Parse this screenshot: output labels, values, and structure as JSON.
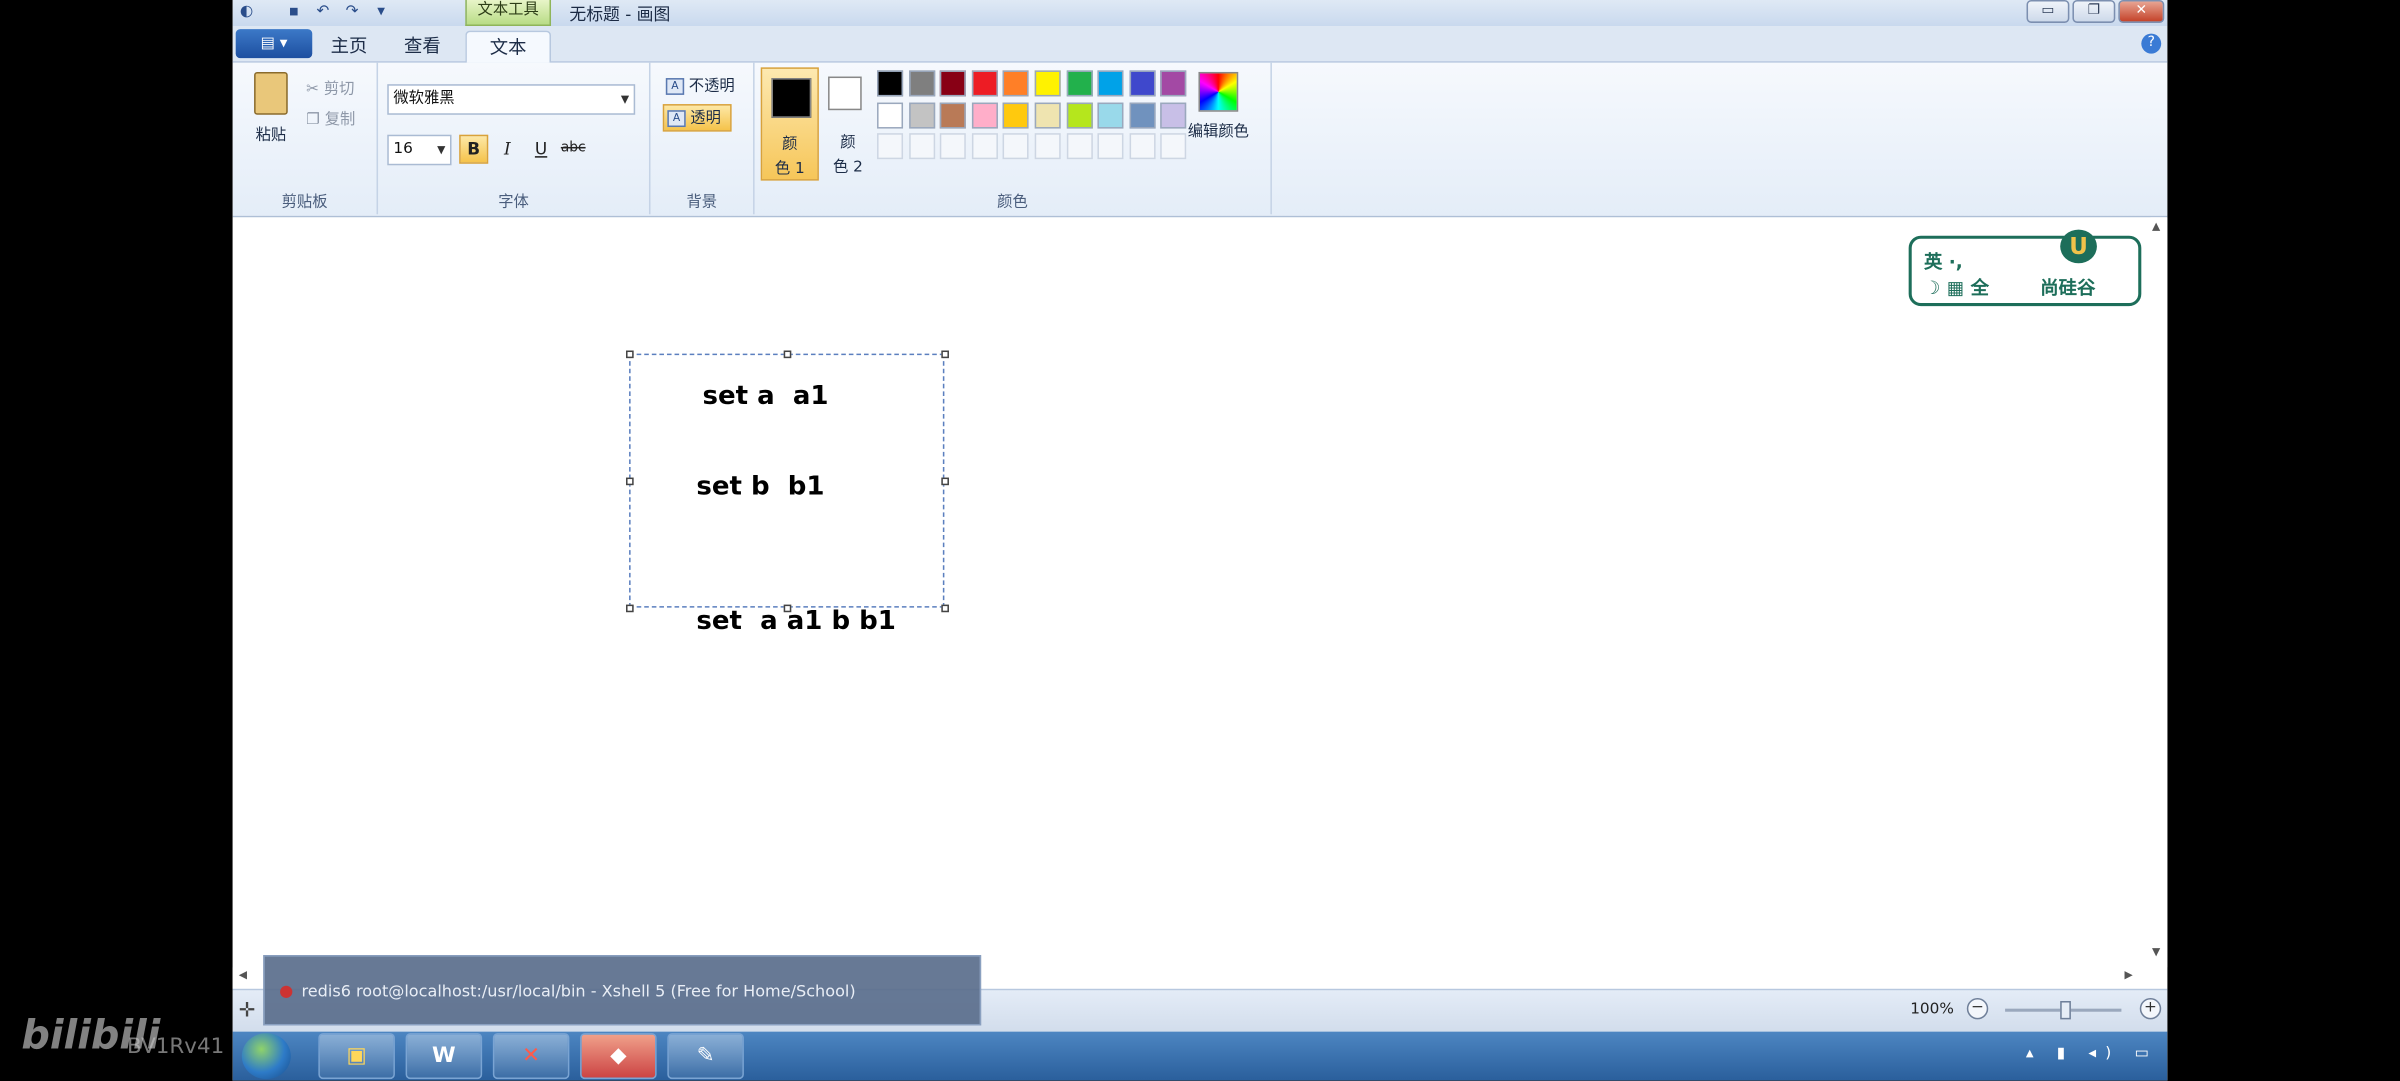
{
  "window": {
    "title": "无标题 - 画图",
    "contextual_tab": "文本工具",
    "controls": {
      "minimize": "▭",
      "restore": "❐",
      "close": "✕"
    }
  },
  "quick_access": [
    "save-icon",
    "undo-icon",
    "redo-icon",
    "customize-icon"
  ],
  "tabs": [
    {
      "label": "主页",
      "active": false
    },
    {
      "label": "查看",
      "active": false
    },
    {
      "label": "文本",
      "active": true
    }
  ],
  "file_menu": "▤ ▾",
  "help": "?",
  "ribbon": {
    "clipboard": {
      "paste": "粘贴",
      "cut": "剪切",
      "copy": "复制",
      "label": "剪贴板"
    },
    "font": {
      "family": "微软雅黑",
      "size": "16",
      "bold": "B",
      "italic": "I",
      "underline": "U",
      "strikethrough": "abc",
      "label": "字体"
    },
    "background": {
      "opaque": "不透明",
      "transparent": "透明",
      "label": "背景"
    },
    "colors": {
      "color1_a": "颜",
      "color1_b": "色 1",
      "color2_a": "颜",
      "color2_b": "色 2",
      "color1_value": "#000000",
      "color2_value": "#ffffff",
      "palette": [
        "#000000",
        "#7f7f7f",
        "#880015",
        "#ed1c24",
        "#ff7f27",
        "#fff200",
        "#22b14c",
        "#00a2e8",
        "#3f48cc",
        "#a349a4",
        "#ffffff",
        "#c3c3c3",
        "#b97a57",
        "#ffaec9",
        "#ffc90e",
        "#efe4b0",
        "#b5e61d",
        "#99d9ea",
        "#7092be",
        "#c8bfe7"
      ],
      "edit": "编辑颜色",
      "label": "颜色"
    }
  },
  "canvas": {
    "lines": [
      "set a  a1",
      "set b  b1",
      "set  a a1 b b1"
    ]
  },
  "logo": {
    "line1": "英 ·, ",
    "line2": "☽ ▦ 全",
    "brand": "尚硅谷",
    "badge": "U"
  },
  "status": {
    "add": "✛",
    "zoom": "100%",
    "zoom_out": "−",
    "zoom_in": "+"
  },
  "taskbar_preview": "redis6    root@localhost:/usr/local/bin - Xshell 5 (Free for Home/School)",
  "taskbar_apps": [
    {
      "name": "explorer",
      "glyph": "▣",
      "color": "#1e7bd6"
    },
    {
      "name": "word",
      "glyph": "W",
      "color": "#2b579a"
    },
    {
      "name": "xmind",
      "glyph": "✕",
      "color": "#e0322f"
    },
    {
      "name": "redis-desktop",
      "glyph": "◆",
      "color": "#c9433a"
    },
    {
      "name": "paint",
      "glyph": "✎",
      "color": "#7aa9d8"
    }
  ],
  "watermark": {
    "logo": "bilibili",
    "bvid": "BV1Rv41"
  }
}
